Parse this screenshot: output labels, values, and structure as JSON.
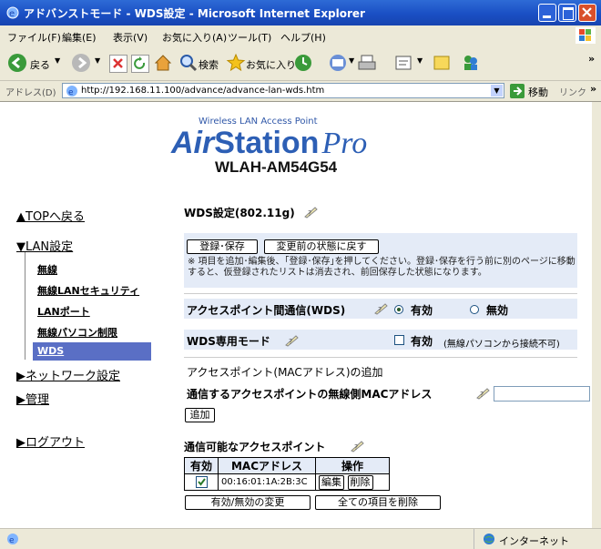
{
  "window": {
    "title": "アドバンストモード - WDS設定 - Microsoft Internet Explorer"
  },
  "menu": [
    "ファイル(F)",
    "編集(E)",
    "表示(V)",
    "お気に入り(A)",
    "ツール(T)",
    "ヘルプ(H)"
  ],
  "toolbar": {
    "back": "戻る",
    "search": "検索",
    "favorites": "お気に入り"
  },
  "address": {
    "label": "アドレス(D)",
    "url": "http://192.168.11.100/advance/advance-lan-wds.htm",
    "go": "移動",
    "links": "リンク"
  },
  "brand": {
    "tagline": "Wireless LAN Access Point",
    "logo_air": "Air",
    "logo_station": "Station",
    "logo_pro": "Pro",
    "model": "WLAH-AM54G54"
  },
  "sidebar": {
    "top": "▲TOPへ戻る",
    "lan": "▼LAN設定",
    "items": [
      "無線",
      "無線LANセキュリティ",
      "LANポート",
      "無線パソコン制限",
      "WDS"
    ],
    "network": "▶ネットワーク設定",
    "admin": "▶管理",
    "logout": "▶ログアウト"
  },
  "main": {
    "heading": "WDS設定(802.11g)",
    "save_button": "登録･保存",
    "restore_button": "変更前の状態に戻す",
    "note": "※ 項目を追加･編集後、｢登録･保存｣を押してください。登録･保存を行う前に別のページに移動すると、仮登録されたリストは消去され、前回保存した状態になります。",
    "ap_comm_label": "アクセスポイント間通信(WDS)",
    "enabled": "有効",
    "disabled": "無効",
    "wds_only_label": "WDS専用モード",
    "wds_only_value": "有効",
    "wds_only_note": "(無線パソコンから接続不可)",
    "add_section": "アクセスポイント(MACアドレス)の追加",
    "mac_field_label": "通信するアクセスポイントの無線側MACアドレス",
    "add_button": "追加",
    "list_heading": "通信可能なアクセスポイント",
    "table_headers": [
      "有効",
      "MACアドレス",
      "操作"
    ],
    "rows": [
      {
        "mac": "00:16:01:1A:2B:3C",
        "edit": "編集",
        "delete": "削除"
      }
    ],
    "toggle_button": "有効/無効の変更",
    "delete_all_button": "全ての項目を削除"
  },
  "status": {
    "zone": "インターネット"
  }
}
